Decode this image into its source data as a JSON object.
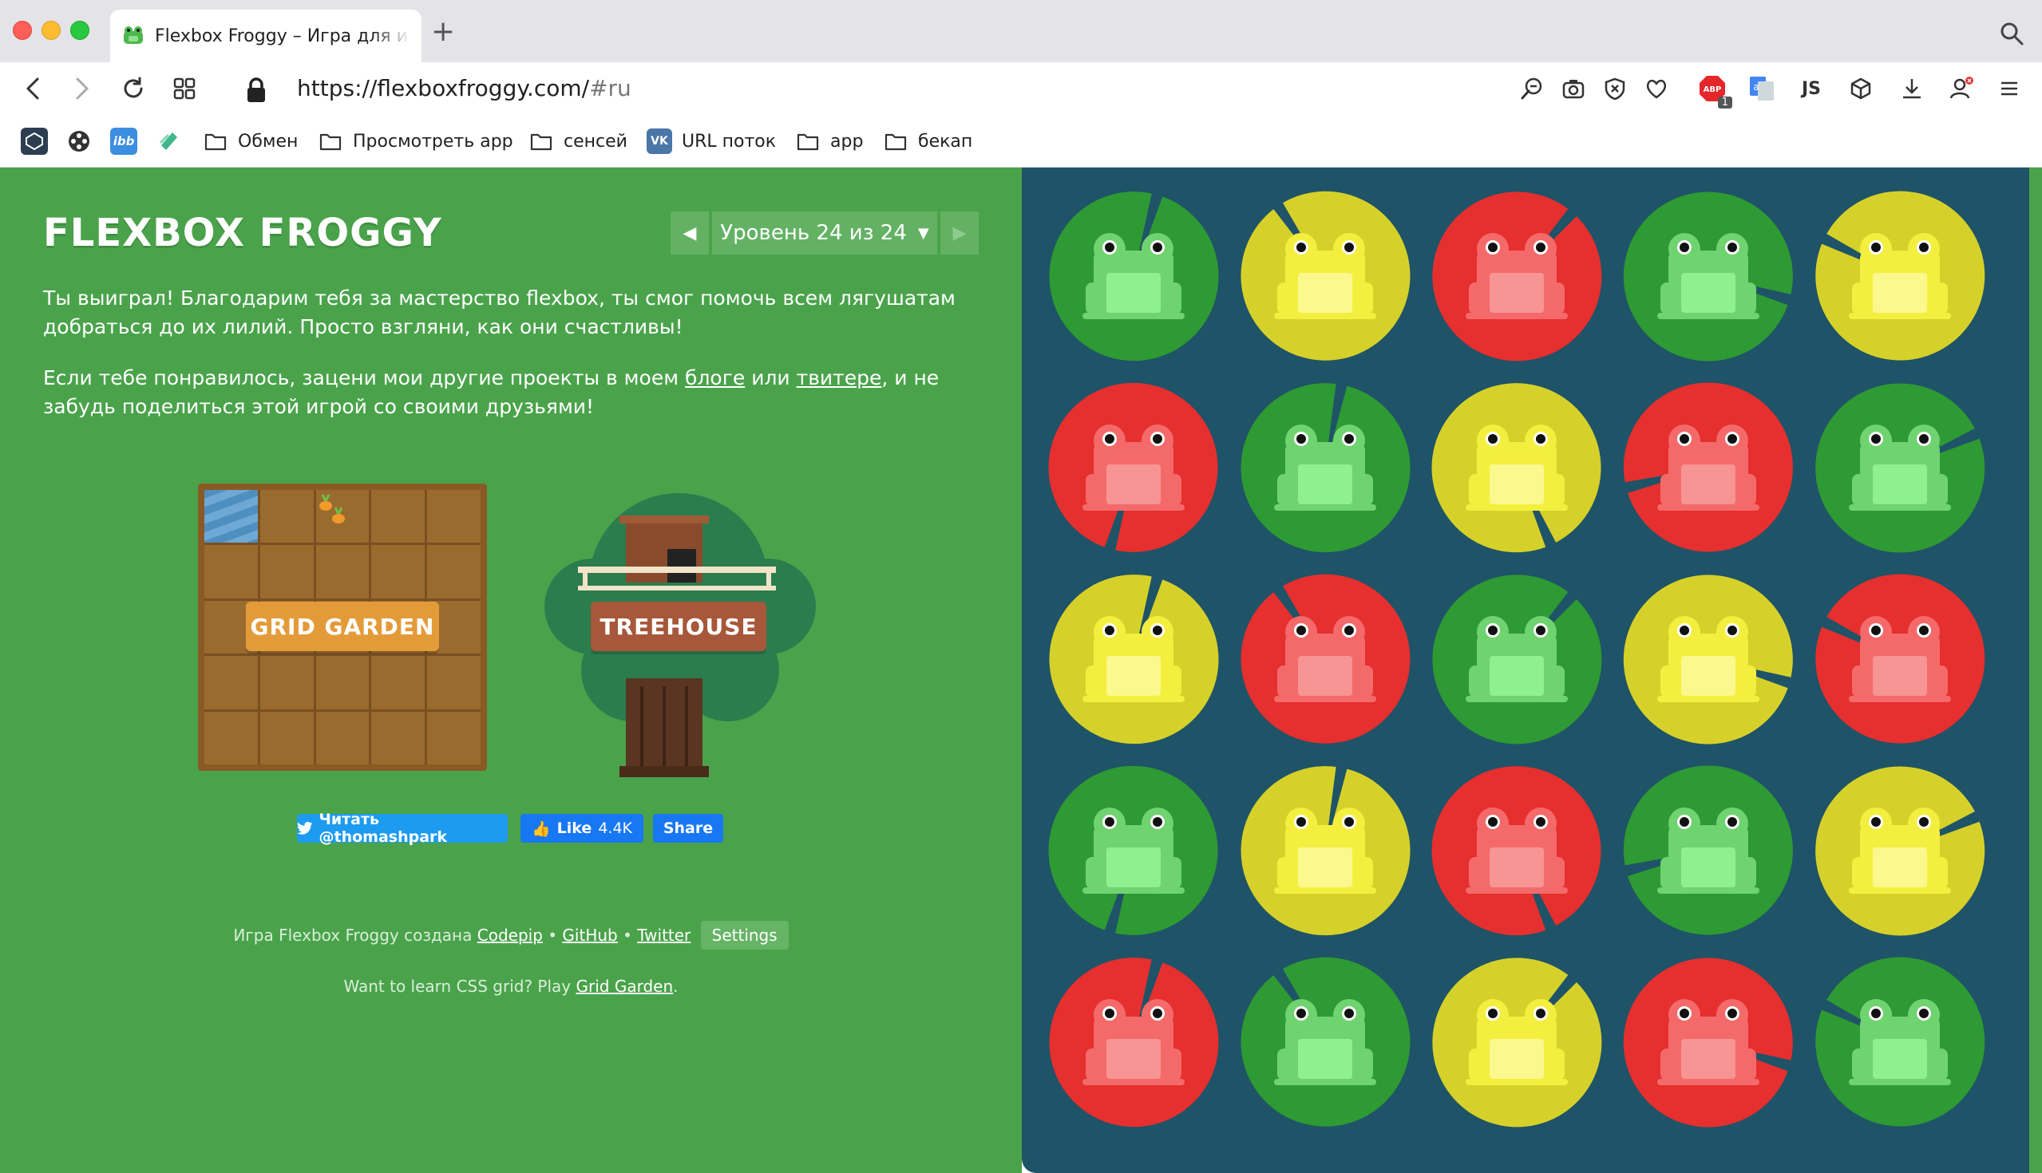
{
  "browser": {
    "tab_title": "Flexbox Froggy – Игра для изучения CSS Flexbox",
    "url_host": "https://flexboxfroggy.com/",
    "url_hash": "#ru"
  },
  "bookmarks": [
    {
      "label": "Обмен",
      "icon": "folder-icon"
    },
    {
      "label": "Просмотреть app",
      "icon": "folder-icon"
    },
    {
      "label": "сенсей",
      "icon": "folder-icon"
    },
    {
      "label": "URL поток",
      "icon": "vk-icon"
    },
    {
      "label": "app",
      "icon": "folder-icon"
    },
    {
      "label": "бекап",
      "icon": "folder-icon"
    }
  ],
  "bookmark_icons": [
    "codepen-icon",
    "film-reel-icon",
    "ibb-icon",
    "pages-icon"
  ],
  "extensions": {
    "adblock_badge": "1",
    "js_label": "JS"
  },
  "game": {
    "logo": "FLEXBOX FROGGY",
    "level_label": "Уровень 24 из 24",
    "win_text": "Ты выиграл! Благодарим тебя за мастерство flexbox, ты смог помочь всем лягушатам добраться до их лилий. Просто взгляни, как они счастливы!",
    "more_text_before": "Если тебе понравилось, зацени мои другие проекты в моем ",
    "blog_link": "блоге",
    "more_text_or": " или ",
    "twitter_link": "твитере",
    "more_text_after": ", и не забудь поделиться этой игрой со своими друзьями!",
    "grid_garden_sign": "GRID GARDEN",
    "treehouse_sign": "TREEHOUSE",
    "tweet_button": "Читать @thomashpark",
    "like_button": "Like",
    "like_count": "4.4K",
    "share_button": "Share",
    "footer_prefix": "Игра Flexbox Froggy создана",
    "footer_codepip": "Codepip",
    "footer_sep": "•",
    "footer_github": "GitHub",
    "footer_twitter": "Twitter",
    "footer_settings": "Settings",
    "footer2_prefix": "Want to learn CSS grid? Play ",
    "footer2_link": "Grid Garden",
    "footer2_suffix": "."
  },
  "frog_colors": {
    "green": {
      "pad": "#2e9a33",
      "frog": "#6fd36f",
      "belly": "#8ff08f"
    },
    "yellow": {
      "pad": "#d6d12a",
      "frog": "#f4ef3f",
      "belly": "#fbf88e"
    },
    "red": {
      "pad": "#e62f2f",
      "frog": "#f46a6a",
      "belly": "#f79494"
    },
    "background": "#1f5367",
    "page_green": "#4aa34b"
  },
  "frog_grid": [
    [
      "green",
      "yellow",
      "red",
      "green",
      "yellow"
    ],
    [
      "red",
      "green",
      "yellow",
      "red",
      "green"
    ],
    [
      "yellow",
      "red",
      "green",
      "yellow",
      "red"
    ],
    [
      "green",
      "yellow",
      "red",
      "green",
      "yellow"
    ],
    [
      "red",
      "green",
      "yellow",
      "red",
      "green"
    ]
  ]
}
